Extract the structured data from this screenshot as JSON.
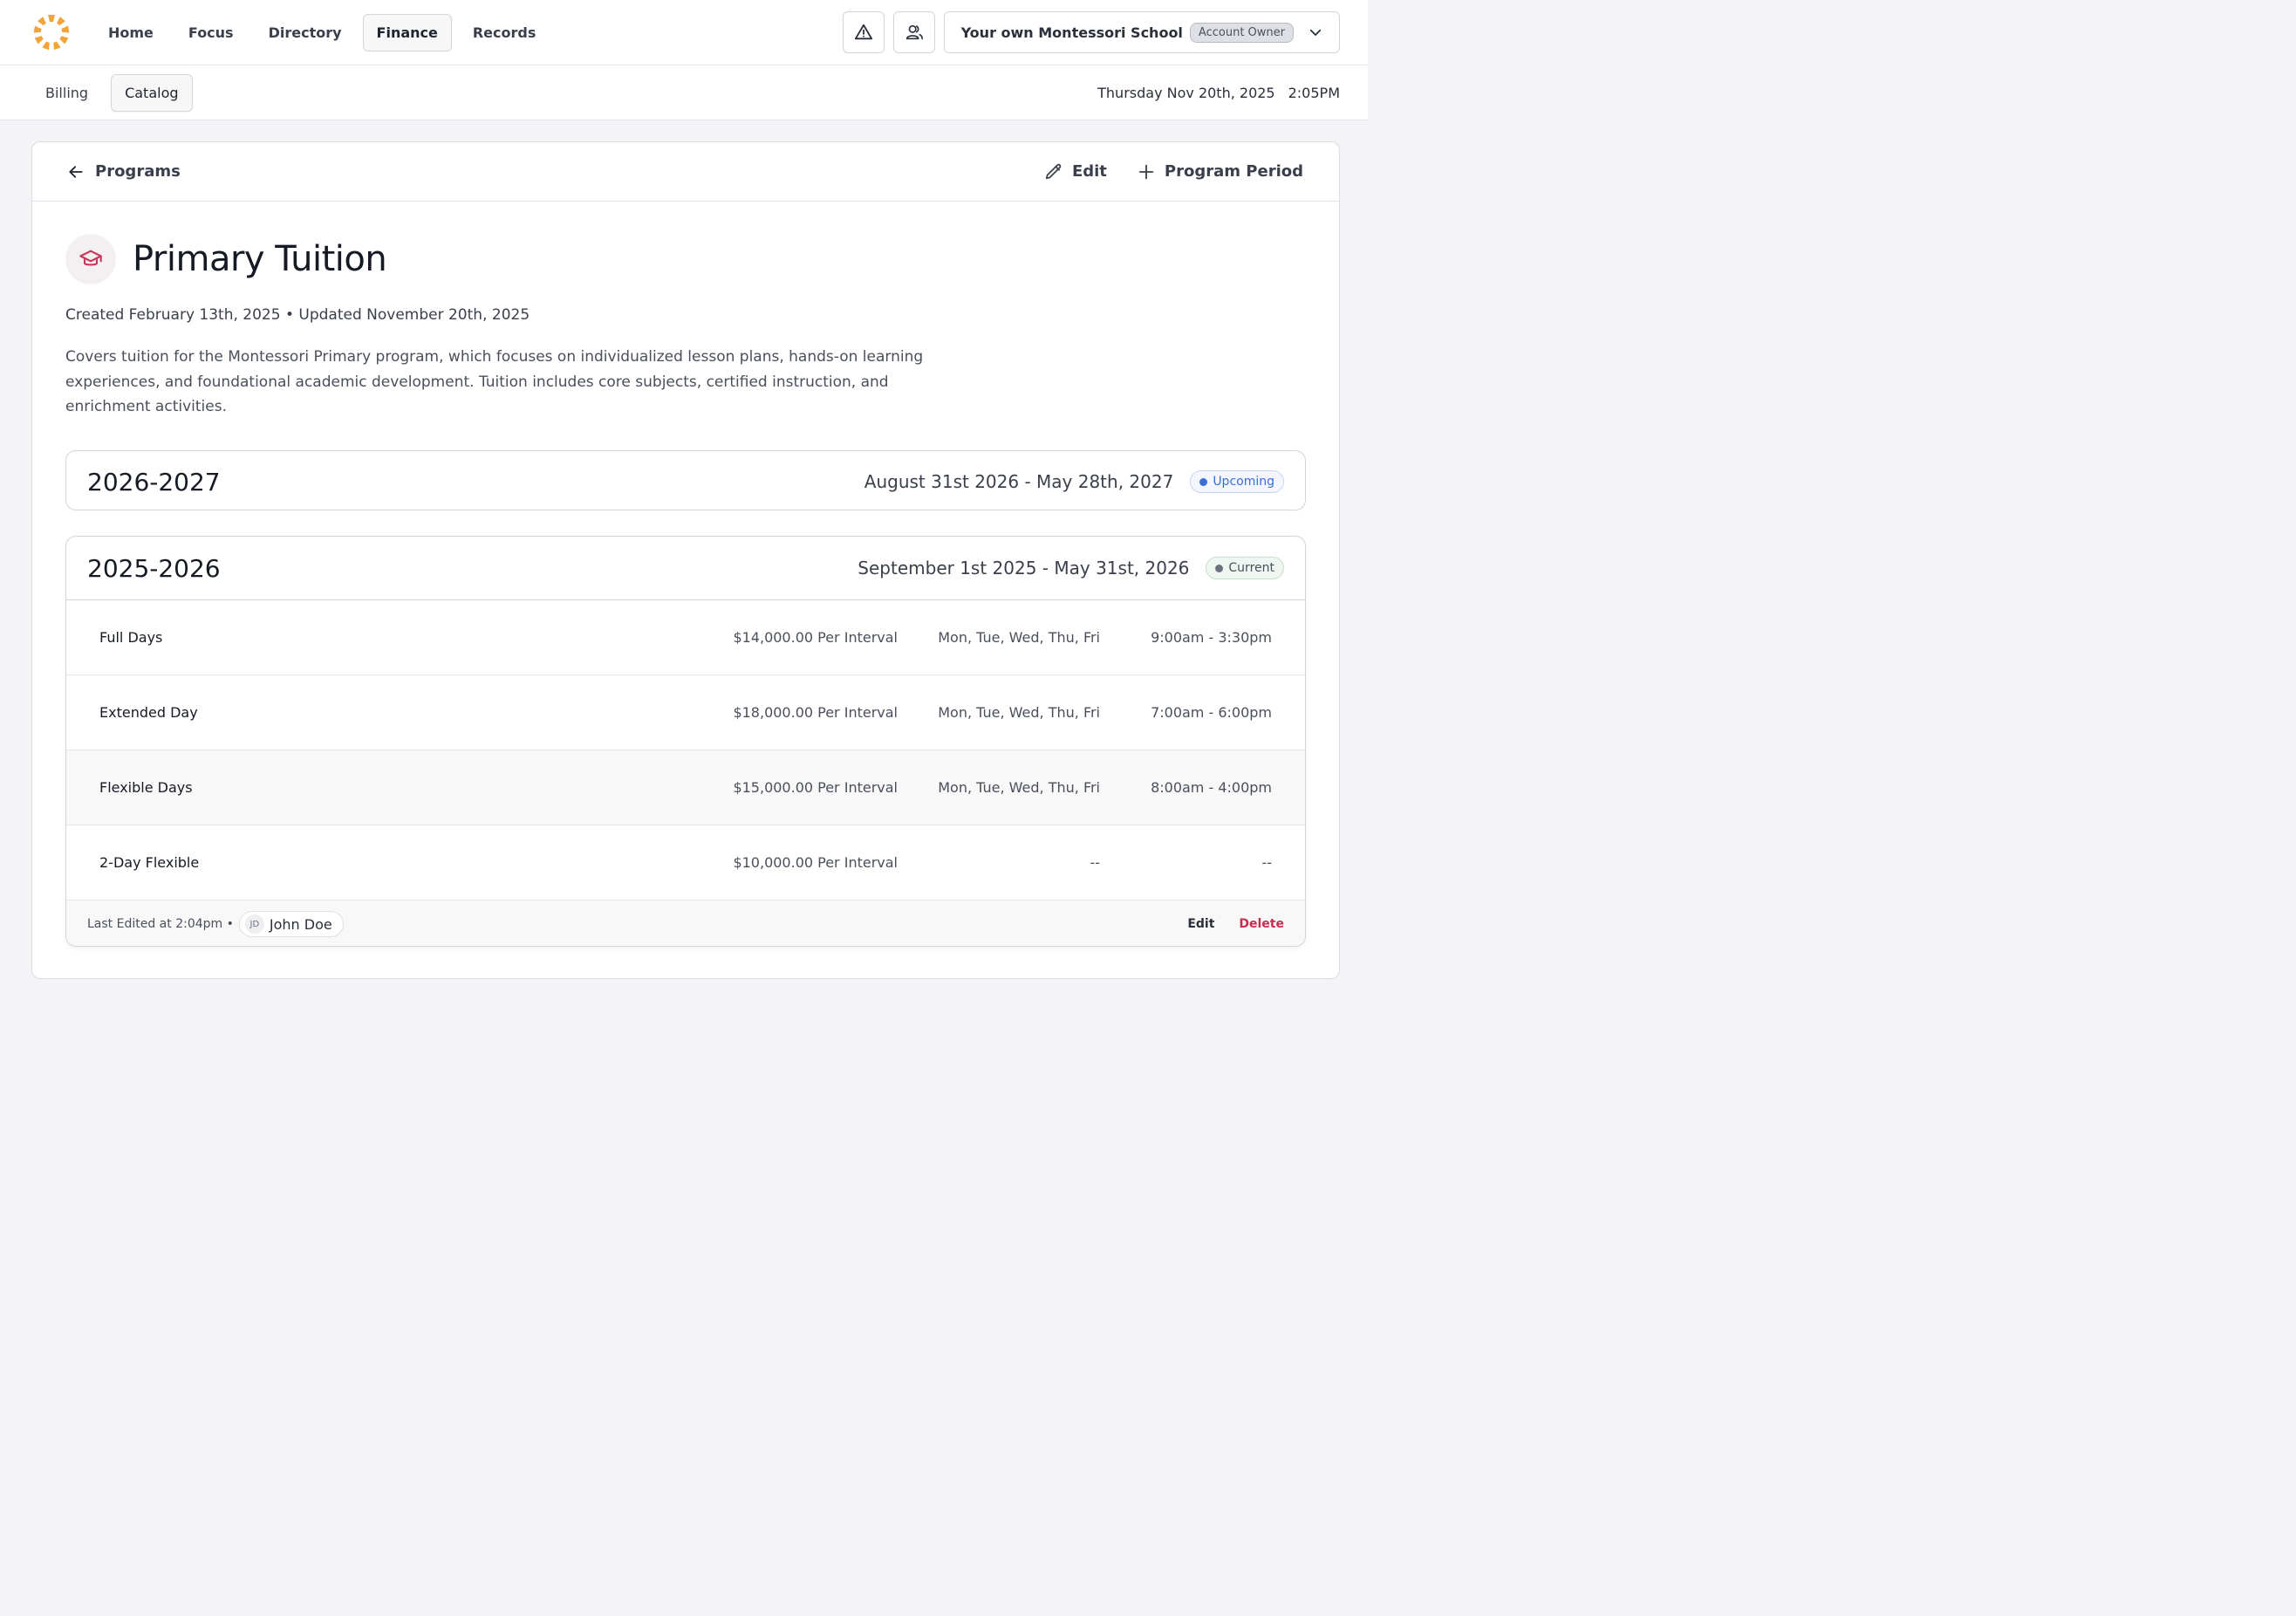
{
  "nav": {
    "items": [
      {
        "label": "Home",
        "active": false
      },
      {
        "label": "Focus",
        "active": false
      },
      {
        "label": "Directory",
        "active": false
      },
      {
        "label": "Finance",
        "active": true
      },
      {
        "label": "Records",
        "active": false
      }
    ]
  },
  "account": {
    "name": "Your own Montessori School",
    "role": "Account Owner"
  },
  "subnav": {
    "items": [
      {
        "label": "Billing",
        "active": false
      },
      {
        "label": "Catalog",
        "active": true
      }
    ]
  },
  "datetime": {
    "date": "Thursday Nov 20th, 2025",
    "time": "2:05PM"
  },
  "card_header": {
    "back_label": "Programs",
    "edit_label": "Edit",
    "add_label": "Program Period"
  },
  "program": {
    "title": "Primary Tuition",
    "meta": "Created February 13th, 2025 • Updated November 20th, 2025",
    "description": "Covers tuition for the Montessori Primary program, which focuses on individualized lesson plans, hands-on learning experiences, and foundational academic development. Tuition includes core subjects, certified instruction, and enrichment activities."
  },
  "periods": [
    {
      "name": "2026-2027",
      "range": "August 31st 2026 - May 28th, 2027",
      "status": "Upcoming",
      "status_color": "#3b6fd4"
    },
    {
      "name": "2025-2026",
      "range": "September 1st 2025 - May 31st, 2026",
      "status": "Current",
      "status_color": "#6b7280",
      "rows": [
        {
          "name": "Full Days",
          "price": "$14,000.00 Per Interval",
          "days": "Mon, Tue, Wed, Thu, Fri",
          "time": "9:00am - 3:30pm"
        },
        {
          "name": "Extended Day",
          "price": "$18,000.00 Per Interval",
          "days": "Mon, Tue, Wed, Thu, Fri",
          "time": "7:00am - 6:00pm"
        },
        {
          "name": "Flexible Days",
          "price": "$15,000.00 Per Interval",
          "days": "Mon, Tue, Wed, Thu, Fri",
          "time": "8:00am - 4:00pm"
        },
        {
          "name": "2-Day Flexible",
          "price": "$10,000.00 Per Interval",
          "days": "--",
          "time": "--"
        }
      ],
      "footer": {
        "last_edited": "Last Edited at 2:04pm •",
        "user_initials": "JD",
        "user_name": "John Doe",
        "edit_label": "Edit",
        "delete_label": "Delete"
      }
    }
  ],
  "colors": {
    "accent_delete": "#c62d4f",
    "logo": "#f0a43a",
    "program_icon": "#c8365d"
  }
}
